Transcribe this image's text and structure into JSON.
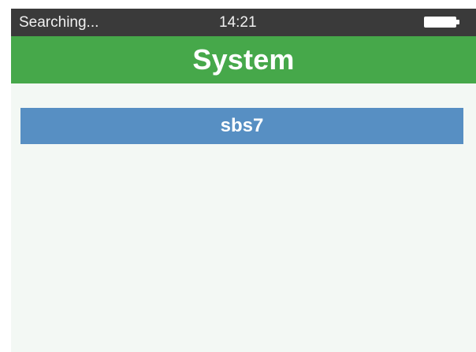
{
  "status_bar": {
    "status_text": "Searching...",
    "time": "14:21",
    "battery_icon": "battery-full-icon",
    "battery_level": 1.0
  },
  "header": {
    "title": "System"
  },
  "list": {
    "items": [
      {
        "label": "sbs7",
        "selected": true
      }
    ]
  },
  "colors": {
    "status_bar_bg": "#3a3a3a",
    "title_bar_bg": "#46a84a",
    "screen_bg": "#f3f8f4",
    "selected_item_bg": "#578fc3",
    "text_light": "#ffffff"
  }
}
